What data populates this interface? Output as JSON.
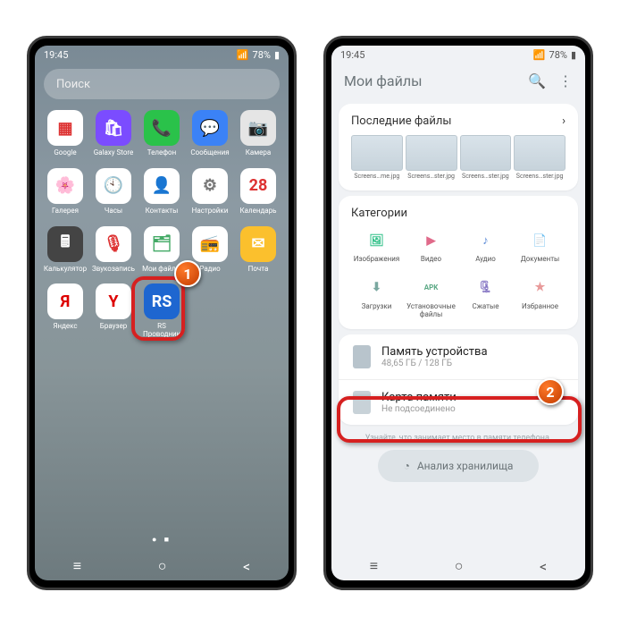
{
  "status": {
    "time": "19:45",
    "battery": "78%"
  },
  "left": {
    "search_placeholder": "Поиск",
    "apps": [
      {
        "label": "Google",
        "bg": "#fff",
        "glyph": "▦",
        "fg": "#d33"
      },
      {
        "label": "Galaxy Store",
        "bg": "#7b4cff",
        "glyph": "🛍"
      },
      {
        "label": "Телефон",
        "bg": "#2ac24a",
        "glyph": "📞"
      },
      {
        "label": "Сообщения",
        "bg": "#3b82f6",
        "glyph": "💬"
      },
      {
        "label": "Камера",
        "bg": "#e5e5e5",
        "glyph": "📷",
        "fg": "#555"
      },
      {
        "label": "Галерея",
        "bg": "#fff",
        "glyph": "🌸"
      },
      {
        "label": "Часы",
        "bg": "#fff",
        "glyph": "🕙",
        "fg": "#333"
      },
      {
        "label": "Контакты",
        "bg": "#fff",
        "glyph": "👤",
        "fg": "#f77"
      },
      {
        "label": "Настройки",
        "bg": "#fff",
        "glyph": "⚙",
        "fg": "#777"
      },
      {
        "label": "Календарь",
        "bg": "#fff",
        "glyph": "28",
        "fg": "#d33"
      },
      {
        "label": "Калькулятор",
        "bg": "#444",
        "glyph": "🖩"
      },
      {
        "label": "Звукозапись",
        "bg": "#fff",
        "glyph": "🎙",
        "fg": "#d33"
      },
      {
        "label": "Мои файлы",
        "bg": "#fff",
        "glyph": "🗂",
        "fg": "#4a6"
      },
      {
        "label": "Радио",
        "bg": "#fff",
        "glyph": "📻",
        "fg": "#a55"
      },
      {
        "label": "Почта",
        "bg": "#fbc02d",
        "glyph": "✉"
      },
      {
        "label": "Яндекс",
        "bg": "#fff",
        "glyph": "Я",
        "fg": "#d00"
      },
      {
        "label": "Браузер",
        "bg": "#fff",
        "glyph": "Y",
        "fg": "#d00"
      },
      {
        "label": "RS Проводник",
        "bg": "#1e66d0",
        "glyph": "RS"
      }
    ]
  },
  "right": {
    "title": "Мои файлы",
    "recent_title": "Последние файлы",
    "recent_thumbs": [
      "Screens…me.jpg",
      "Screens…ster.jpg",
      "Screens…ster.jpg",
      "Screens…ster.jpg"
    ],
    "categories_title": "Категории",
    "categories": [
      {
        "label": "Изображения",
        "glyph": "🖼",
        "c": "#36c28b"
      },
      {
        "label": "Видео",
        "glyph": "▶",
        "c": "#e06a8a"
      },
      {
        "label": "Аудио",
        "glyph": "♪",
        "c": "#5a89d6"
      },
      {
        "label": "Документы",
        "glyph": "📄",
        "c": "#f0a046"
      },
      {
        "label": "Загрузки",
        "glyph": "⬇",
        "c": "#7aa8a0"
      },
      {
        "label": "Установочные файлы",
        "glyph": "APK",
        "c": "#5aa884"
      },
      {
        "label": "Сжатые",
        "glyph": "🗜",
        "c": "#8676c4"
      },
      {
        "label": "Избранное",
        "glyph": "★",
        "c": "#e89a9a"
      }
    ],
    "storage": [
      {
        "title": "Память устройства",
        "sub": "48,65 ГБ / 128 ГБ"
      },
      {
        "title": "Карта памяти",
        "sub": "Не подсоединено"
      }
    ],
    "hint": "Узнайте, что занимает место в памяти телефона.",
    "analyse": "Анализ хранилища"
  }
}
